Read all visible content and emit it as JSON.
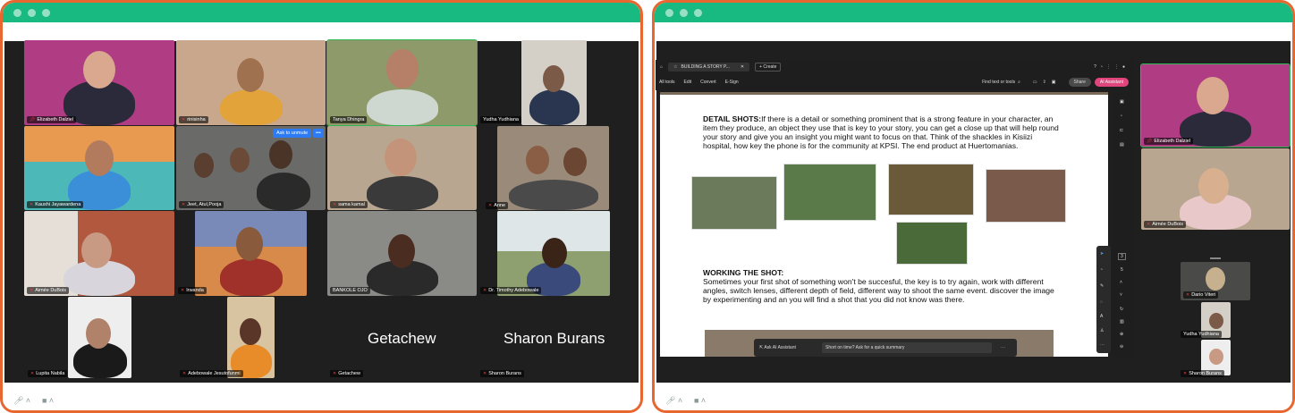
{
  "left_call": {
    "participants": [
      {
        "name": "Elizabeth Dalziel",
        "pinned": true
      },
      {
        "name": "rinisinha",
        "muted": true
      },
      {
        "name": "Tanya Dhingra",
        "active": true
      },
      {
        "name": "Yudha Yudhiana"
      },
      {
        "name": "Kaushi Jayawardena",
        "muted": true
      },
      {
        "name": "Jeet, Atul,Pooja",
        "muted": true
      },
      {
        "name": "sama kamal",
        "muted": true
      },
      {
        "name": "Anne",
        "muted": true
      },
      {
        "name": "Aimée DuBois",
        "muted": true
      },
      {
        "name": "Irwanda",
        "muted": true
      },
      {
        "name": "BANKOLE OJO"
      },
      {
        "name": "Dr. Timothy Adebowale",
        "muted": true
      },
      {
        "name": "Lupita Nabila",
        "muted": true
      },
      {
        "name": "Adebowale Jesutofunmi",
        "muted": true
      },
      {
        "name": "Getachew",
        "muted": true,
        "big_label": "Getachew"
      },
      {
        "name": "Sharon Burans",
        "muted": true,
        "big_label": "Sharon Burans"
      }
    ],
    "ask_to_unmute": "Ask to unmute",
    "more_dots": "•••"
  },
  "right_call": {
    "pdf": {
      "tab_title": "BUILDING A STORY P...",
      "create": "Create",
      "menu": [
        "All tools",
        "Edit",
        "Convert",
        "E-Sign"
      ],
      "find": "Find text or tools",
      "share": "Share",
      "ai_assistant": "AI Assistant",
      "page_number": "3",
      "page_total": "5",
      "heading1": "DETAIL SHOTS:",
      "para1": "If there is a detail or something prominent that is a strong feature in your character, an item they produce, an object they use that is key to your story, you can get a close up that will help round your story and give you an insight  you might want to focus on that. Think of the shackles in Kisiizi hospital, how key the phone is for the community at KPSI. The end product at Huertomanias.",
      "heading2": "WORKING THE SHOT:",
      "para2": "  Sometimes your first shot of something won't be succesful, the key is to try again, work with different angles, switch lenses, different depth of field, different way to shoot the same event. discover the image by experimenting and an you will find a shot that you did not know was there.",
      "ask_ai": "Ask AI Assistant",
      "short_on_time": "Short on time? Ask for a quick summary"
    },
    "participants": [
      {
        "name": "Elizabeth Dalziel",
        "pinned": true
      },
      {
        "name": "Aimée DuBois",
        "muted": true
      },
      {
        "name": "Dario Viteri",
        "muted": true
      },
      {
        "name": "Yudha Yudhiana"
      },
      {
        "name": "Sharon Burans",
        "muted": true
      }
    ]
  },
  "colors": {
    "titlebar": "#19ba82",
    "frame": "#e8662f",
    "active_speaker": "#2fb855",
    "ai_button": "#e0457b"
  }
}
